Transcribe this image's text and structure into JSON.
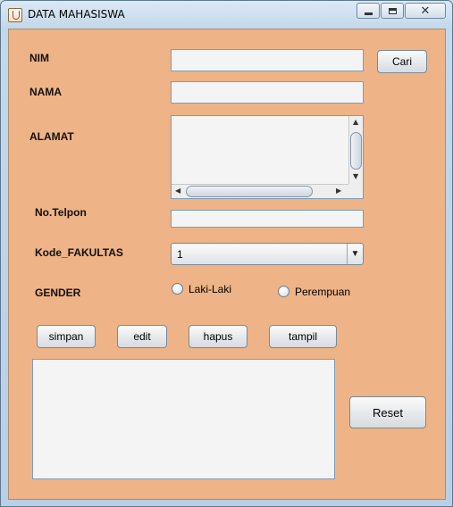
{
  "window": {
    "title": "DATA MAHASISWA",
    "controls": {
      "minimize": "minimize",
      "maximize": "maximize",
      "close": "✕"
    }
  },
  "form": {
    "nim": {
      "label": "NIM",
      "value": ""
    },
    "nama": {
      "label": "NAMA",
      "value": ""
    },
    "alamat": {
      "label": "ALAMAT",
      "value": ""
    },
    "telpon": {
      "label": "No.Telpon",
      "value": ""
    },
    "fakultas": {
      "label": "Kode_FAKULTAS",
      "selected": "1"
    },
    "gender": {
      "label": "GENDER",
      "options": [
        "Laki-Laki",
        "Perempuan"
      ],
      "selected": null
    }
  },
  "buttons": {
    "cari": "Cari",
    "simpan": "simpan",
    "edit": "edit",
    "hapus": "hapus",
    "tampil": "tampil",
    "reset": "Reset"
  },
  "output": {
    "value": ""
  },
  "colors": {
    "panel_bg": "#eeb386",
    "title_bar": "#c4d8eb"
  },
  "icons": {
    "app": "java-cup-icon",
    "combo_arrow": "chevron-down-icon"
  }
}
